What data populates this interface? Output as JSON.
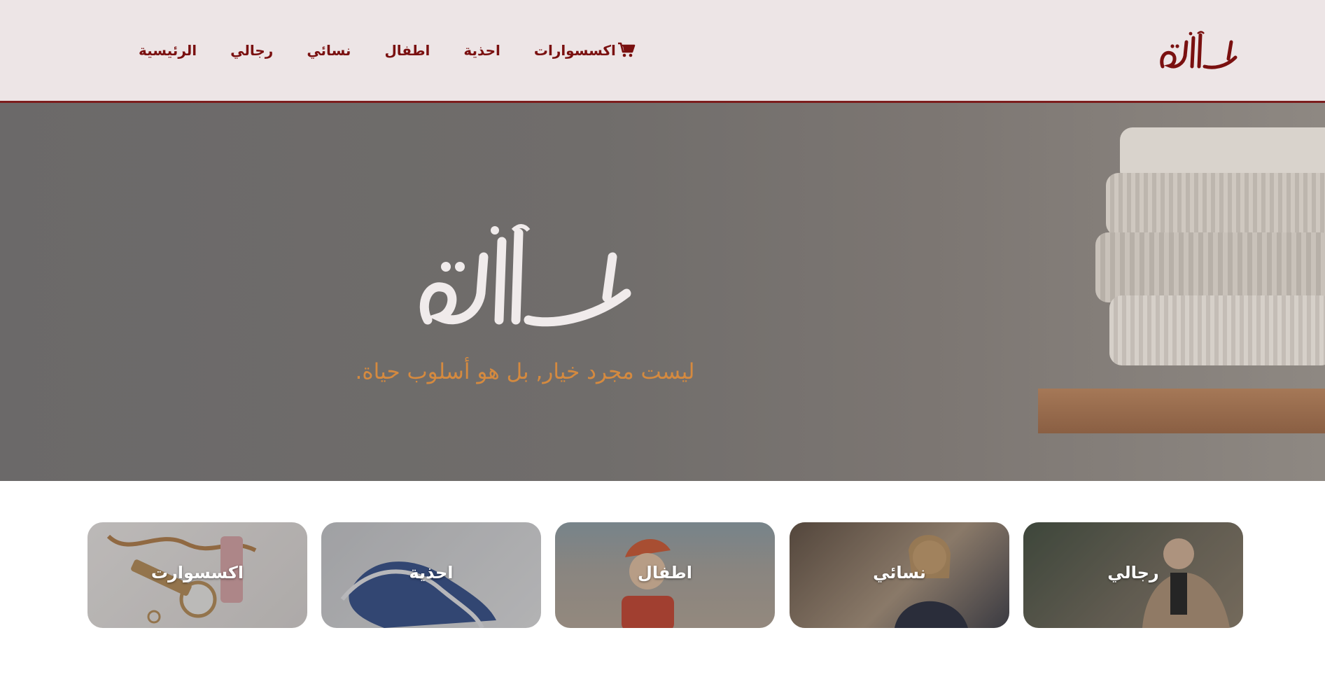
{
  "brand": {
    "logo_text": "الأناقة",
    "accent_color": "#7a1010"
  },
  "nav": {
    "items": [
      "الرئيسية",
      "رجالي",
      "نسائي",
      "اطفال",
      "احذية",
      "اكسسوارات"
    ],
    "cart_icon": "shopping-cart-icon"
  },
  "hero": {
    "logo_text": "الأناقة",
    "tagline": "ليست مجرد خيار, بل هو أسلوب حياة.",
    "tagline_color": "#d58a3f"
  },
  "categories": [
    {
      "label": "اكسسوارت"
    },
    {
      "label": "احذية"
    },
    {
      "label": "اطفال"
    },
    {
      "label": "نسائي"
    },
    {
      "label": "رجالي"
    }
  ]
}
